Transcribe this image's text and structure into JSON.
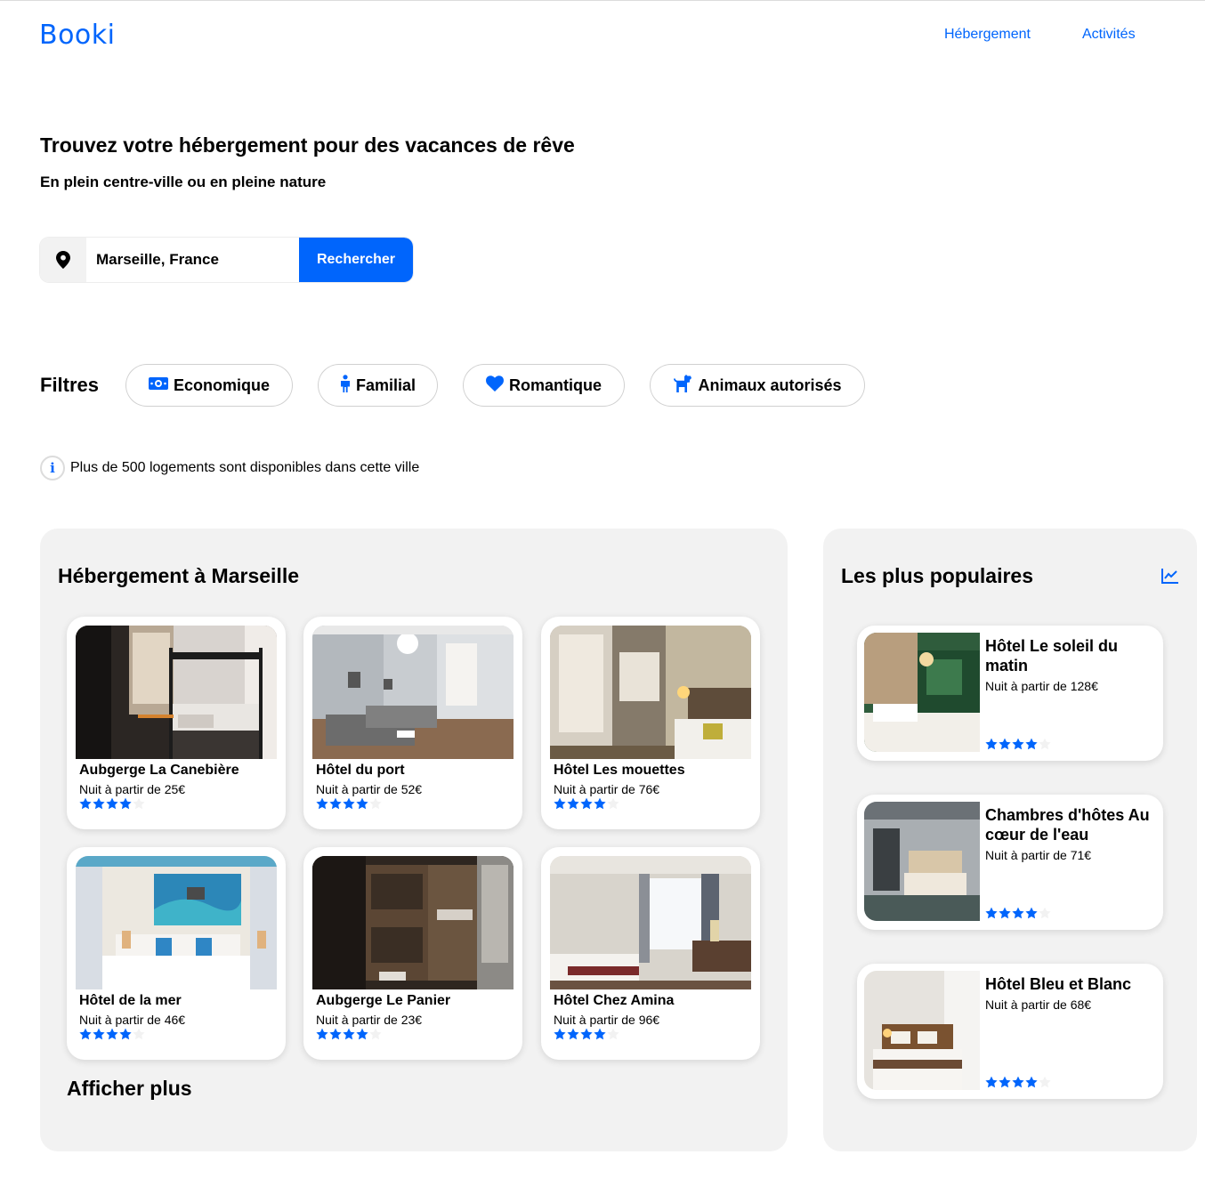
{
  "header": {
    "logo": "Booki",
    "nav": [
      "Hébergement",
      "Activités"
    ]
  },
  "hero": {
    "title": "Trouvez votre hébergement pour des vacances de rêve",
    "subtitle": "En plein centre-ville ou en pleine nature"
  },
  "search": {
    "icon": "location-pin-icon",
    "value": "Marseille, France",
    "button_label": "Rechercher"
  },
  "filters": {
    "label": "Filtres",
    "chips": [
      {
        "label": "Economique",
        "icon": "money-icon"
      },
      {
        "label": "Familial",
        "icon": "child-icon"
      },
      {
        "label": "Romantique",
        "icon": "heart-icon"
      },
      {
        "label": "Animaux autorisés",
        "icon": "dog-icon"
      }
    ]
  },
  "info": {
    "icon": "info-icon",
    "text": "Plus de 500 logements sont disponibles dans cette ville"
  },
  "accommodations": {
    "title": "Hébergement à Marseille",
    "more_label": "Afficher plus",
    "items": [
      {
        "name": "Aubgerge La Canebière",
        "price": "Nuit à partir de 25€",
        "rating": 4
      },
      {
        "name": "Hôtel du port",
        "price": "Nuit à partir de 52€",
        "rating": 4
      },
      {
        "name": "Hôtel Les mouettes",
        "price": "Nuit à partir de 76€",
        "rating": 4
      },
      {
        "name": "Hôtel de la mer",
        "price": "Nuit à partir de 46€",
        "rating": 4
      },
      {
        "name": "Aubgerge Le Panier",
        "price": "Nuit à partir de 23€",
        "rating": 4
      },
      {
        "name": "Hôtel Chez Amina",
        "price": "Nuit à partir de 96€",
        "rating": 4
      }
    ]
  },
  "popular": {
    "title": "Les plus populaires",
    "icon": "trend-chart-icon",
    "items": [
      {
        "name": "Hôtel Le soleil du matin",
        "price": "Nuit à partir de 128€",
        "rating": 4
      },
      {
        "name": "Chambres d'hôtes Au cœur de l'eau",
        "price": "Nuit à partir de 71€",
        "rating": 4
      },
      {
        "name": "Hôtel Bleu et Blanc",
        "price": "Nuit à partir de 68€",
        "rating": 4
      }
    ]
  },
  "colors": {
    "accent": "#0065fc",
    "panel": "#f2f2f2",
    "star_empty": "#f2f2f2"
  }
}
